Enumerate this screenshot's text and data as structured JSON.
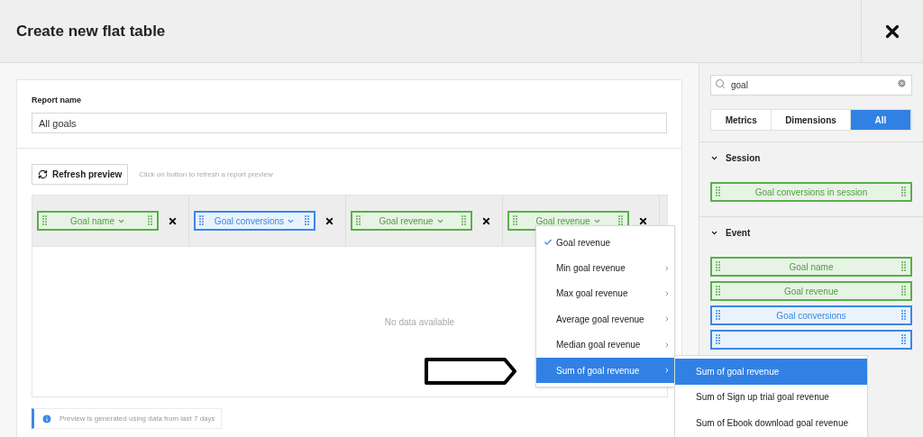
{
  "dialog": {
    "title": "Create new flat table"
  },
  "report_name": {
    "label": "Report name",
    "value": "All goals"
  },
  "refresh": {
    "button": "Refresh preview",
    "hint": "Click on button to refresh a report preview"
  },
  "columns": [
    {
      "label": "Goal name",
      "kind": "dimension"
    },
    {
      "label": "Goal conversions",
      "kind": "metric"
    },
    {
      "label": "Goal revenue",
      "kind": "dimension"
    },
    {
      "label": "Goal revenue",
      "kind": "dimension"
    }
  ],
  "empty_text": "No data available",
  "info": "Preview is generated using data from last 7 days",
  "column_menu": {
    "items": [
      {
        "label": "Goal revenue",
        "checked": true,
        "has_submenu": false,
        "selected": false
      },
      {
        "label": "Min goal revenue",
        "checked": false,
        "has_submenu": true,
        "selected": false
      },
      {
        "label": "Max goal revenue",
        "checked": false,
        "has_submenu": true,
        "selected": false
      },
      {
        "label": "Average goal revenue",
        "checked": false,
        "has_submenu": true,
        "selected": false
      },
      {
        "label": "Median goal revenue",
        "checked": false,
        "has_submenu": true,
        "selected": false
      },
      {
        "label": "Sum of goal revenue",
        "checked": false,
        "has_submenu": true,
        "selected": true
      }
    ]
  },
  "submenu": {
    "items": [
      {
        "label": "Sum of goal revenue",
        "selected": true
      },
      {
        "label": "Sum of Sign up trial goal revenue",
        "selected": false
      },
      {
        "label": "Sum of Ebook download goal revenue",
        "selected": false
      }
    ]
  },
  "sidebar": {
    "search": {
      "value": "goal"
    },
    "tabs": [
      {
        "label": "Metrics",
        "selected": false
      },
      {
        "label": "Dimensions",
        "selected": false
      },
      {
        "label": "All",
        "selected": true
      }
    ],
    "groups": [
      {
        "title": "Session",
        "expanded": true,
        "items": [
          {
            "label": "Goal conversions in session",
            "kind": "dimension"
          }
        ]
      },
      {
        "title": "Event",
        "expanded": true,
        "items": [
          {
            "label": "Goal name",
            "kind": "dimension"
          },
          {
            "label": "Goal revenue",
            "kind": "dimension"
          },
          {
            "label": "Goal conversions",
            "kind": "metric"
          },
          {
            "kind": "metric"
          }
        ]
      }
    ]
  }
}
